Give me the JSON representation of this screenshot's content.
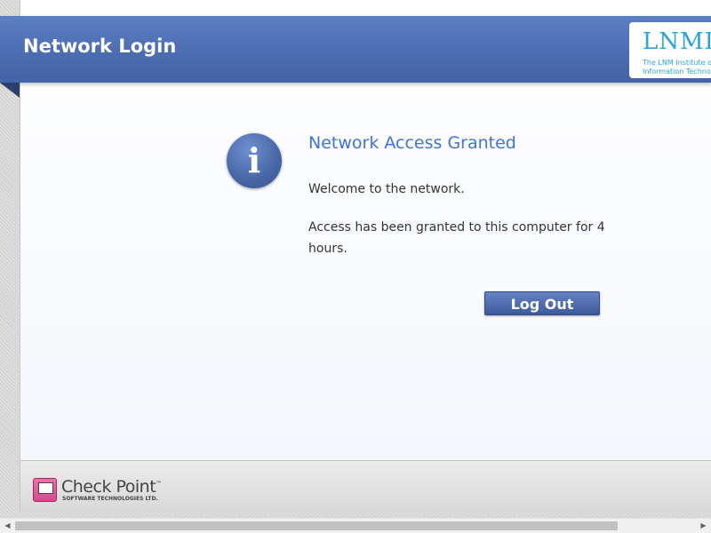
{
  "header": {
    "title": "Network Login",
    "logo": {
      "text": "LNMI",
      "subtitle_line1": "The LNM Institute of",
      "subtitle_line2": "Information Technology",
      "color": "#2aa3dc"
    }
  },
  "message": {
    "icon": "info-icon",
    "title": "Network Access Granted",
    "welcome": "Welcome to the network.",
    "access": "Access has been granted to this computer for 4 hours."
  },
  "actions": {
    "logout_label": "Log Out"
  },
  "footer": {
    "brand": "Check Point",
    "trademark": "™",
    "brand_sub": "SOFTWARE TECHNOLOGIES LTD."
  },
  "scrollbar": {
    "left_arrow": "◀",
    "right_arrow": "▶"
  },
  "colors": {
    "header_blue": "#4c6db1",
    "title_blue": "#3f74d6",
    "button_blue": "#4a67a8"
  }
}
